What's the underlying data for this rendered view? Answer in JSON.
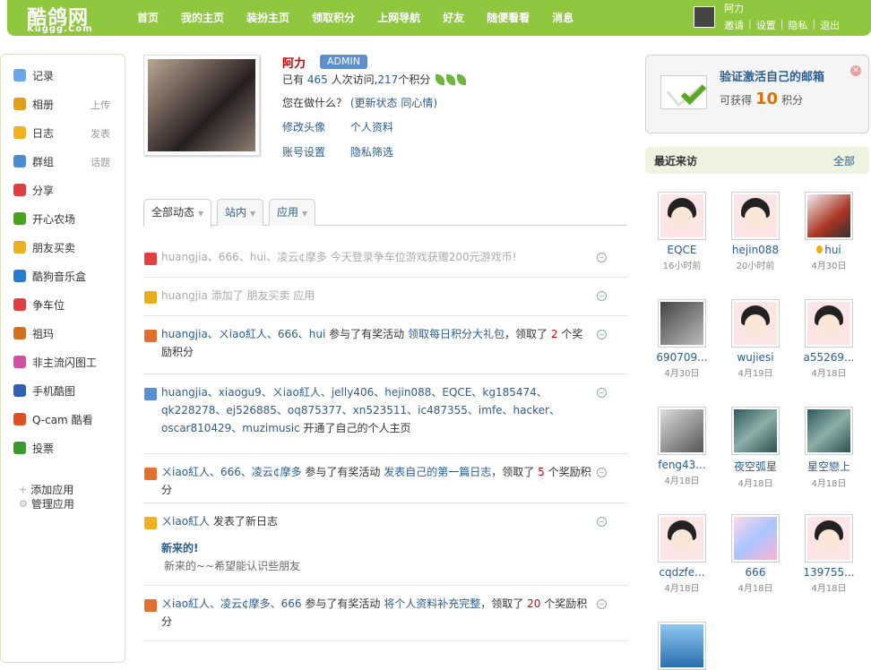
{
  "header": {
    "logo": "酷鸽网",
    "logo_sub": "Kuggg.Com",
    "nav": [
      "首页",
      "我的主页",
      "装扮主页",
      "领取积分",
      "上网导航",
      "好友",
      "随便看看",
      "消息"
    ],
    "user_name": "阿力",
    "links": [
      "邀请",
      "设置",
      "隐私",
      "退出"
    ]
  },
  "sidebar": {
    "items": [
      {
        "label": "记录",
        "extra": "",
        "icon": "chat-bubble-icon",
        "color": "#6aa6e8"
      },
      {
        "label": "相册",
        "extra": "上传",
        "icon": "photo-icon",
        "color": "#e0a020"
      },
      {
        "label": "日志",
        "extra": "发表",
        "icon": "notebook-icon",
        "color": "#f0b020"
      },
      {
        "label": "群组",
        "extra": "话题",
        "icon": "group-icon",
        "color": "#4a8cd0"
      },
      {
        "label": "分享",
        "extra": "",
        "icon": "heart-share-icon",
        "color": "#e04040"
      },
      {
        "label": "开心农场",
        "extra": "",
        "icon": "sprout-icon",
        "color": "#4aa020"
      },
      {
        "label": "朋友买卖",
        "extra": "",
        "icon": "coins-icon",
        "color": "#e8b020"
      },
      {
        "label": "酷狗音乐盒",
        "extra": "",
        "icon": "kugou-icon",
        "color": "#2a7ad0"
      },
      {
        "label": "争车位",
        "extra": "",
        "icon": "parking-icon",
        "color": "#e04040"
      },
      {
        "label": "祖玛",
        "extra": "",
        "icon": "zuma-icon",
        "color": "#d07020"
      },
      {
        "label": "非主流闪图工",
        "extra": "",
        "icon": "flash-image-icon",
        "color": "#d050a0"
      },
      {
        "label": "手机酷图",
        "extra": "",
        "icon": "mobile-icon",
        "color": "#3060b0"
      },
      {
        "label": "Q-cam 酷看",
        "extra": "",
        "icon": "camera-icon",
        "color": "#e05020"
      },
      {
        "label": "投票",
        "extra": "",
        "icon": "chart-icon",
        "color": "#3a9a30"
      }
    ],
    "add_app": "添加应用",
    "manage_app": "管理应用"
  },
  "profile": {
    "name": "阿力",
    "badge": "ADMIN",
    "visits_prefix": "已有",
    "visits": "465",
    "visits_mid": "人次访问,",
    "points": "217",
    "points_suffix": "个积分",
    "doing_label": "您在做什么？",
    "update_status": "(更新状态",
    "mood": "同心情)",
    "links_row1": [
      "修改头像",
      "个人资料"
    ],
    "links_row2": [
      "账号设置",
      "隐私筛选"
    ]
  },
  "tabs": [
    "全部动态",
    "站内",
    "应用"
  ],
  "feed": [
    {
      "icon": "parking-icon",
      "color": "#e04040",
      "grey": true,
      "users": "huangjia、666、hui、凌云¢摩多",
      "action": "今天登录争车位游戏获赠200元游戏币!",
      "lines": 1
    },
    {
      "icon": "coins-icon",
      "color": "#e8b020",
      "grey": true,
      "users": "huangjia",
      "action": "添加了 朋友买卖 应用",
      "lines": 1
    },
    {
      "icon": "gift-icon",
      "color": "#e07030",
      "grey": false,
      "users": "huangjia、ㄨiao紅人、666、hui",
      "action": "参与了有奖活动",
      "link": "领取每日积分大礼包",
      "reward_prefix": "，领取了",
      "reward": "2",
      "reward_suffix": "个奖励积分",
      "lines": 2
    },
    {
      "icon": "profile-card-icon",
      "color": "#5a8ad0",
      "grey": false,
      "users": "huangjia、xiaogu9、ㄨiao紅人、jelly406、hejin088、EQCE、kg185474、qk228278、ej526885、oq875377、xn523511、ic487355、imfe、hacker、oscar810429、muzimusic",
      "action": "开通了自己的个人主页",
      "lines": 3
    },
    {
      "icon": "gift-icon",
      "color": "#e07030",
      "grey": false,
      "users": "ㄨiao紅人、666、凌云¢摩多",
      "action": "参与了有奖活动",
      "link": "发表自己的第一篇日志",
      "reward_prefix": "，领取了",
      "reward": "5",
      "reward_suffix": "个奖励积分",
      "lines": 2
    },
    {
      "icon": "notebook-icon",
      "color": "#f0b020",
      "grey": false,
      "users": "ㄨiao紅人",
      "action": "发表了新日志",
      "post_title": "新来的!",
      "post_body": "新来的~~希望能认识些朋友",
      "lines": 1
    },
    {
      "icon": "gift-icon",
      "color": "#e07030",
      "grey": false,
      "users": "ㄨiao紅人、凌云¢摩多、666",
      "action": "参与了有奖活动",
      "link": "将个人资料补充完整",
      "reward_prefix": "，领取了",
      "reward": "20",
      "reward_suffix": "个奖励积分",
      "lines": 2
    }
  ],
  "verify": {
    "title": "验证激活自己的邮箱",
    "sub_prefix": "可获得",
    "points": "10",
    "sub_suffix": "积分"
  },
  "recent": {
    "title": "最近来访",
    "all": "全部",
    "visitors": [
      {
        "name": "EQCE",
        "time": "16小时前",
        "style": "cartoon"
      },
      {
        "name": "hejin088",
        "time": "20小时前",
        "style": "cartoon"
      },
      {
        "name": "hui",
        "time": "4月30日",
        "style": "red",
        "online": true
      },
      {
        "name": "690709...",
        "time": "4月30日",
        "style": "dark"
      },
      {
        "name": "wujiesi",
        "time": "4月19日",
        "style": "cartoon"
      },
      {
        "name": "a55269...",
        "time": "4月18日",
        "style": "cartoon"
      },
      {
        "name": "feng43...",
        "time": "4月18日",
        "style": "photo"
      },
      {
        "name": "夜空弧星",
        "time": "4月18日",
        "style": "teal"
      },
      {
        "name": "星空戀上",
        "time": "4月18日",
        "style": "teal"
      },
      {
        "name": "cqdzfe...",
        "time": "4月18日",
        "style": "cartoon"
      },
      {
        "name": "666",
        "time": "4月18日",
        "style": "anime"
      },
      {
        "name": "139755...",
        "time": "4月18日",
        "style": "cartoon"
      },
      {
        "name": "",
        "time": "",
        "style": "blue"
      }
    ]
  }
}
